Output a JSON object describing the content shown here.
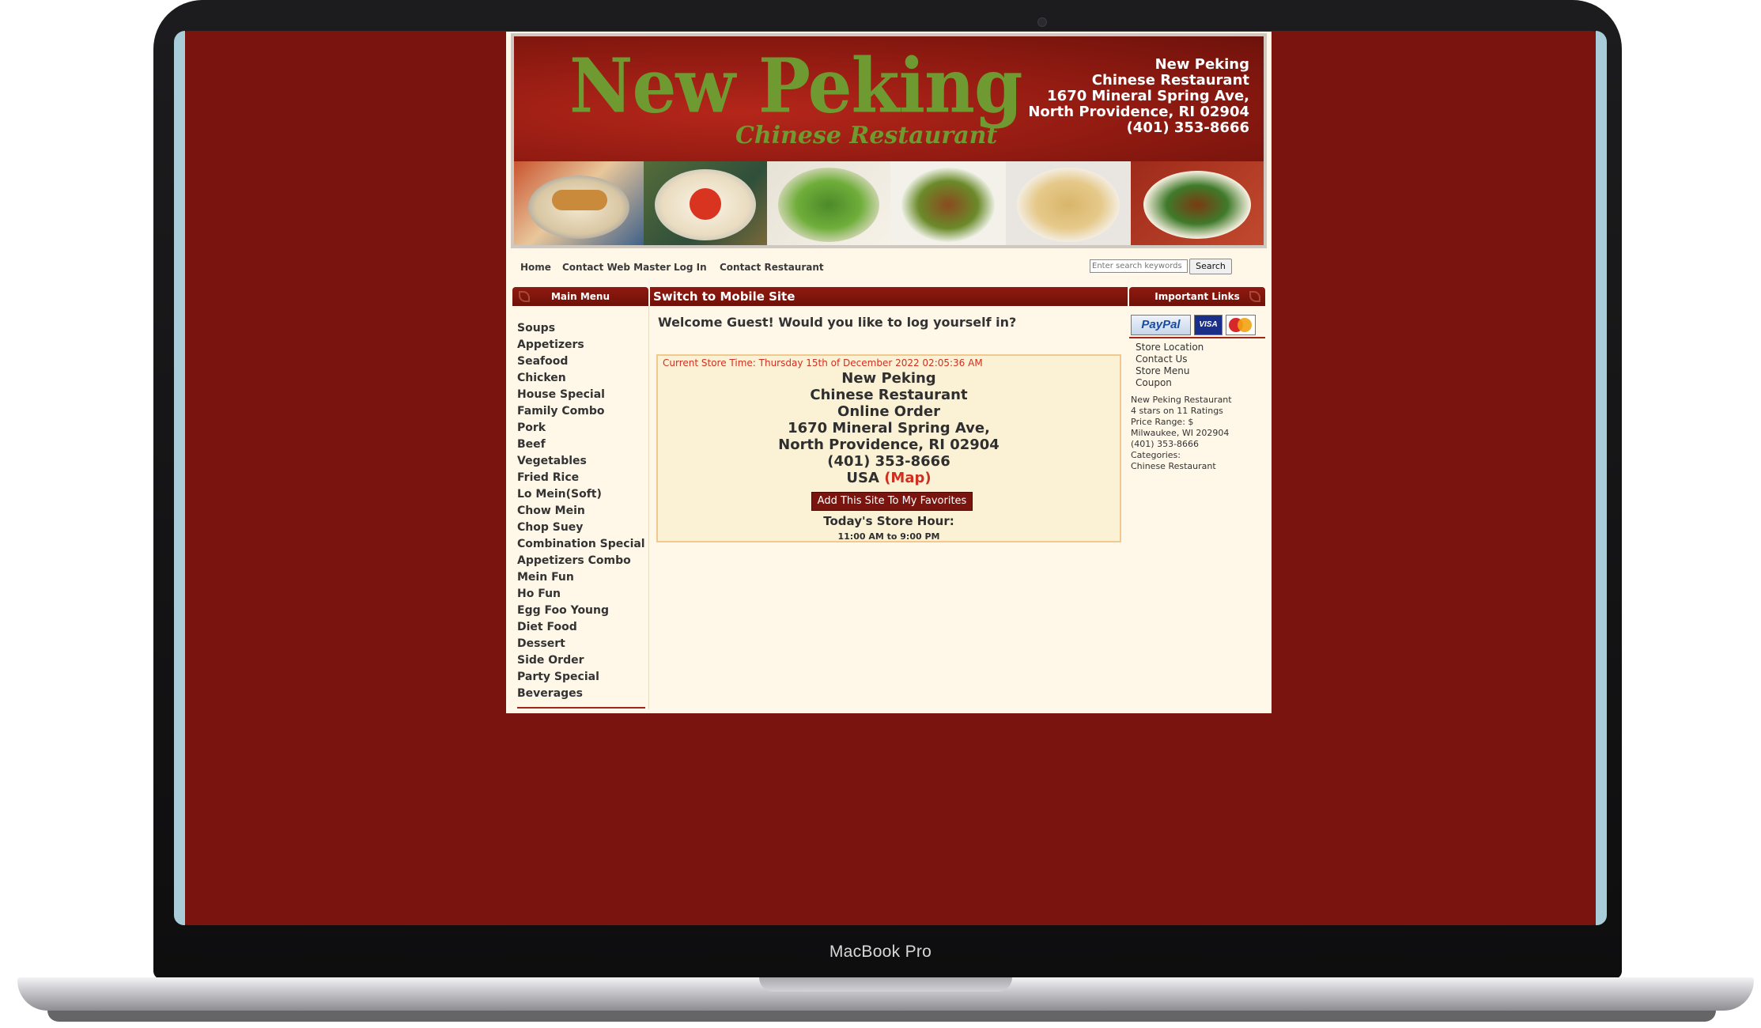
{
  "device": {
    "label": "MacBook Pro"
  },
  "header": {
    "logo_main": "New Peking",
    "logo_sub": "Chinese Restaurant",
    "address_lines": [
      "New Peking",
      "Chinese Restaurant",
      "1670 Mineral Spring Ave,",
      "North Providence, RI 02904",
      "(401) 353-8666"
    ]
  },
  "nav": {
    "links": [
      "Home",
      "Contact Web Master",
      "Log In",
      "Contact Restaurant"
    ],
    "search_placeholder": "Enter search keywords",
    "search_button": "Search"
  },
  "sections": {
    "main_menu": "Main Menu",
    "switch_mobile": "Switch to Mobile Site",
    "important_links": "Important Links"
  },
  "menu": [
    "Soups",
    "Appetizers",
    "Seafood",
    "Chicken",
    "House Special",
    "Family Combo",
    "Pork",
    "Beef",
    "Vegetables",
    "Fried Rice",
    "Lo Mein(Soft)",
    "Chow Mein",
    "Chop Suey",
    "Combination Special",
    "Appetizers Combo",
    "Mein Fun",
    "Ho Fun",
    "Egg Foo Young",
    "Diet Food",
    "Dessert",
    "Side Order",
    "Party Special",
    "Beverages"
  ],
  "main": {
    "welcome": "Welcome Guest! Would you like to log yourself in?",
    "store_time": "Current Store Time: Thursday 15th of December 2022 02:05:36 AM",
    "store_lines": [
      "New Peking",
      "Chinese Restaurant",
      "Online Order",
      "1670 Mineral Spring Ave,",
      "North Providence, RI 02904",
      "(401) 353-8666"
    ],
    "country": "USA",
    "map_link": "(Map)",
    "favorites_button": "Add This Site To My Favorites",
    "hours_title": "Today's Store Hour:",
    "hours_value": "11:00 AM to 9:00 PM"
  },
  "sidebar": {
    "payments": {
      "paypal": "PayPal",
      "visa": "VISA"
    },
    "links": [
      "Store Location",
      "Contact Us",
      "Store Menu",
      "Coupon"
    ],
    "info": [
      "New Peking Restaurant",
      "4 stars on 11 Ratings",
      "Price Range: $",
      "Milwaukee, WI 202904",
      "(401) 353-8666",
      "Categories:",
      "Chinese Restaurant"
    ]
  },
  "colors": {
    "background": "#7a140e",
    "accent": "#8f1a10",
    "logo_green": "#6f9a32",
    "link_red": "#d0301f"
  }
}
